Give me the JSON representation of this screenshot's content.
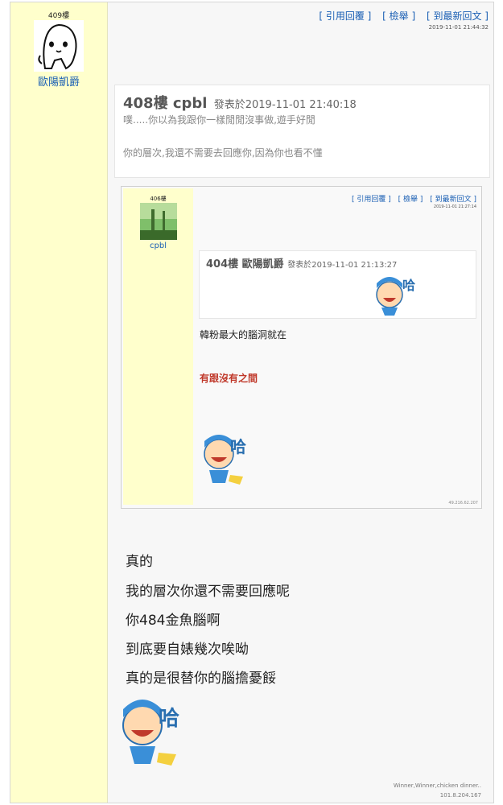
{
  "post": {
    "floor": "409樓",
    "username": "歐陽凱爵",
    "actions": {
      "quote": "[ 引用回覆 ]",
      "report": "[ 檢舉 ]",
      "latest": "[ 到最新回文 ]"
    },
    "timestamp": "2019-11-01 21:44:32",
    "quote": {
      "floor_user": "408樓 cpbl",
      "meta": "發表於2019-11-01 21:40:18",
      "line1": "噗.....你以為我跟你一樣閒閒沒事做,遊手好閒",
      "line2": "你的層次,我還不需要去回應你,因為你也看不懂"
    },
    "content_lines": [
      "真的",
      "我的層次你還不需要回應呢",
      "你484金魚腦啊",
      "到底要自婊幾次唉呦",
      "真的是很替你的腦擔憂餒"
    ],
    "footer_line1": "Winner,Winner,chicken dinner..",
    "footer_line2": "101.8.204.167"
  },
  "embedded": {
    "floor": "406樓",
    "username": "cpbl",
    "actions": {
      "quote": "[ 引用回覆 ]",
      "report": "[ 檢舉 ]",
      "latest": "[ 到最新回文 ]"
    },
    "timestamp": "2019-11-01 21:27:14",
    "quote": {
      "floor_user": "404樓 歐陽凱爵",
      "meta": "發表於2019-11-01 21:13:27"
    },
    "line1": "韓粉最大的腦洞就在",
    "line2": "有跟沒有之間",
    "ip": "49.216.62.207"
  },
  "sticker_text": "哈",
  "colors": {
    "sidebar": "#ffffcc",
    "link": "#1a5fb4",
    "highlight": "#c0392b"
  }
}
